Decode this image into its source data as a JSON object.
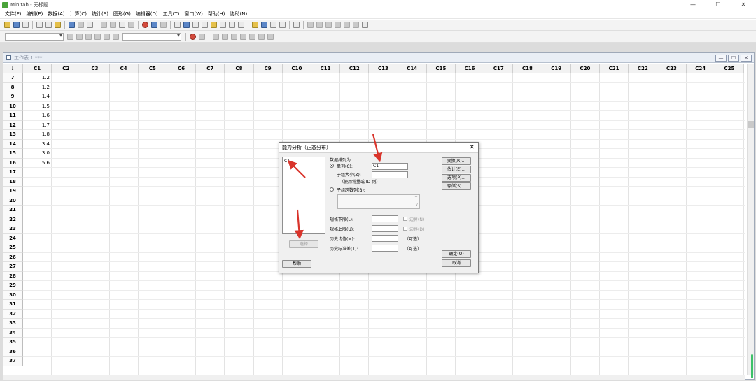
{
  "window": {
    "title": "Minitab - 无标题",
    "controls": [
      "—",
      "☐",
      "✕"
    ]
  },
  "menu": [
    "文件(F)",
    "编辑(E)",
    "数据(A)",
    "计算(C)",
    "统计(S)",
    "图形(G)",
    "编辑器(D)",
    "工具(T)",
    "窗口(W)",
    "帮助(H)",
    "协助(N)"
  ],
  "worksheet": {
    "title": "工作表 1 ***",
    "controls": [
      "—",
      "☐",
      "✕"
    ],
    "corner": "↓",
    "columns": [
      "C1",
      "C2",
      "C3",
      "C4",
      "C5",
      "C6",
      "C7",
      "C8",
      "C9",
      "C10",
      "C11",
      "C12",
      "C13",
      "C14",
      "C15",
      "C16",
      "C17",
      "C18",
      "C19",
      "C20",
      "C21",
      "C22",
      "C23",
      "C24",
      "C25"
    ],
    "rows": [
      "7",
      "8",
      "9",
      "10",
      "11",
      "12",
      "13",
      "14",
      "15",
      "16",
      "17",
      "18",
      "19",
      "20",
      "21",
      "22",
      "23",
      "24",
      "25",
      "26",
      "27",
      "28",
      "29",
      "30",
      "31",
      "32",
      "33",
      "34",
      "35",
      "36",
      "37"
    ],
    "c1_values": [
      "1.2",
      "1.2",
      "1.4",
      "1.5",
      "1.6",
      "1.7",
      "1.8",
      "3.4",
      "3.0",
      "5.6"
    ]
  },
  "dialog": {
    "title": "能力分析（正态分布）",
    "close": "✕",
    "column_list": [
      "C1"
    ],
    "select_button": "选择",
    "help_button": "帮助",
    "data_arranged_label": "数据排列为",
    "single_column_label": "单列(C):",
    "single_column_value": "C1",
    "subgroup_size_label": "子组大小(Z):",
    "subgroup_hint": "（使用常量或 ID 列）",
    "subgroups_across_label": "子组跨数列(B):",
    "lsl_label": "规格下限(L):",
    "usl_label": "规格上限(U):",
    "boundary_label": "边界(N)",
    "boundary2_label": "边界(D)",
    "hist_mean_label": "历史均值(M):",
    "hist_std_label": "历史标准差(T):",
    "optional_label": "（可选）",
    "transform_button": "变换(R)...",
    "estimate_button": "估计(E)...",
    "options_button": "选项(P)...",
    "storage_button": "存储(S)...",
    "ok_button": "确定(O)",
    "cancel_button": "取消"
  },
  "colors": {
    "annotation_arrow": "#d9342b",
    "scroll_marker": "#3ec26a"
  }
}
